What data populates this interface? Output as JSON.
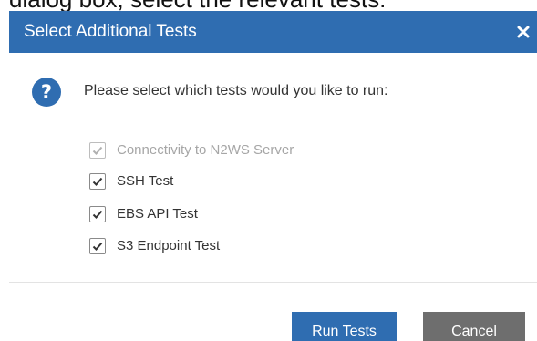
{
  "caption": "dialog box, select the relevant tests:",
  "dialog": {
    "title": "Select Additional Tests",
    "close_glyph": "✖",
    "prompt": "Please select which tests would you like to run:",
    "tests": [
      {
        "label": "Connectivity to N2WS Server",
        "checked": true,
        "disabled": true
      },
      {
        "label": "SSH Test",
        "checked": true,
        "disabled": false
      },
      {
        "label": "EBS API Test",
        "checked": true,
        "disabled": false
      },
      {
        "label": "S3 Endpoint Test",
        "checked": true,
        "disabled": false
      }
    ],
    "buttons": {
      "run_label": "Run Tests",
      "cancel_label": "Cancel"
    }
  },
  "icons": {
    "close": "close-icon",
    "help": "question-icon",
    "check": "checkmark-icon"
  },
  "colors": {
    "titlebar": "#2f6db1",
    "primary_button": "#2f6db1",
    "secondary_button": "#6e6e6e",
    "disabled_text": "#a6a6a6"
  }
}
